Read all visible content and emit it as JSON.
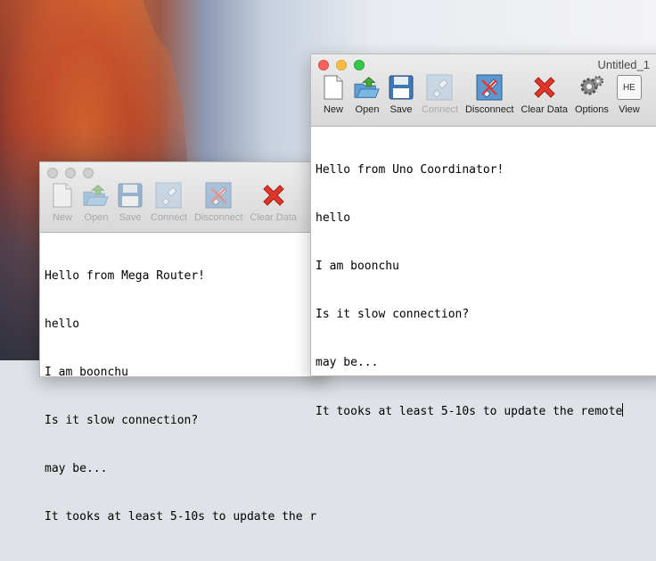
{
  "windows": {
    "back": {
      "toolbar": [
        {
          "label": "New",
          "icon": "new-document-icon",
          "enabled": false
        },
        {
          "label": "Open",
          "icon": "open-folder-icon",
          "enabled": false
        },
        {
          "label": "Save",
          "icon": "floppy-disk-icon",
          "enabled": false
        },
        {
          "label": "Connect",
          "icon": "plug-connect-icon",
          "enabled": false
        },
        {
          "label": "Disconnect",
          "icon": "plug-disconnect-icon",
          "enabled": false
        },
        {
          "label": "Clear Data",
          "icon": "red-x-icon",
          "enabled": false
        }
      ],
      "lines": [
        "Hello from Mega Router!",
        "hello",
        "I am boonchu",
        "Is it slow connection?",
        "may be...",
        "It tooks at least 5-10s to update the r"
      ]
    },
    "front": {
      "title": "Untitled_1",
      "toolbar": [
        {
          "label": "New",
          "icon": "new-document-icon",
          "enabled": true
        },
        {
          "label": "Open",
          "icon": "open-folder-icon",
          "enabled": true
        },
        {
          "label": "Save",
          "icon": "floppy-disk-icon",
          "enabled": true
        },
        {
          "label": "Connect",
          "icon": "plug-connect-icon",
          "enabled": false
        },
        {
          "label": "Disconnect",
          "icon": "plug-disconnect-icon",
          "enabled": true
        },
        {
          "label": "Clear Data",
          "icon": "red-x-icon",
          "enabled": true
        },
        {
          "label": "Options",
          "icon": "gears-icon",
          "enabled": true
        },
        {
          "label": "View",
          "icon": "hex-view-icon",
          "enabled": true
        }
      ],
      "lines": [
        "Hello from Uno Coordinator!",
        "hello",
        "I am boonchu",
        "Is it slow connection?",
        "may be...",
        "It tooks at least 5-10s to update the remote"
      ],
      "hex_icon_text": "HE"
    }
  }
}
